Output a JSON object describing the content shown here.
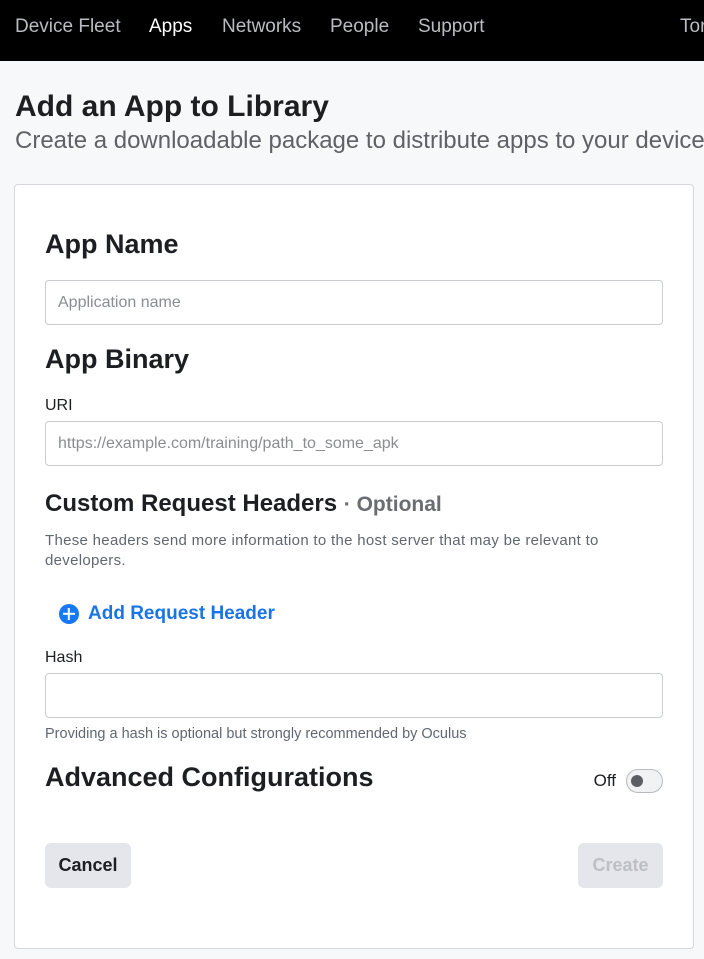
{
  "nav": {
    "items": [
      {
        "label": "Device Fleet",
        "active": false
      },
      {
        "label": "Apps",
        "active": true
      },
      {
        "label": "Networks",
        "active": false
      },
      {
        "label": "People",
        "active": false
      },
      {
        "label": "Support",
        "active": false
      }
    ],
    "user": "Tor"
  },
  "page": {
    "title": "Add an App to Library",
    "subtitle": "Create a downloadable package to distribute apps to your devices"
  },
  "form": {
    "app_name": {
      "heading": "App Name",
      "placeholder": "Application name",
      "value": ""
    },
    "app_binary": {
      "heading": "App Binary",
      "uri_label": "URI",
      "uri_placeholder": "https://example.com/training/path_to_some_apk",
      "uri_value": ""
    },
    "custom_headers": {
      "heading": "Custom Request Headers",
      "optional": "· Optional",
      "description": "These headers send more information to the host server that may be relevant to developers.",
      "add_label": "Add Request Header"
    },
    "hash": {
      "label": "Hash",
      "value": "",
      "helper": "Providing a hash is optional but strongly recommended by Oculus"
    },
    "advanced": {
      "heading": "Advanced Configurations",
      "toggle_label": "Off",
      "enabled": false
    },
    "actions": {
      "cancel_label": "Cancel",
      "create_label": "Create",
      "create_enabled": false
    }
  },
  "colors": {
    "nav_bg": "#000000",
    "accent": "#1877f2",
    "button_bg": "#e4e6eb",
    "disabled_text": "#bcc0c4"
  },
  "icons": {
    "add_header": "plus-circle-icon"
  }
}
